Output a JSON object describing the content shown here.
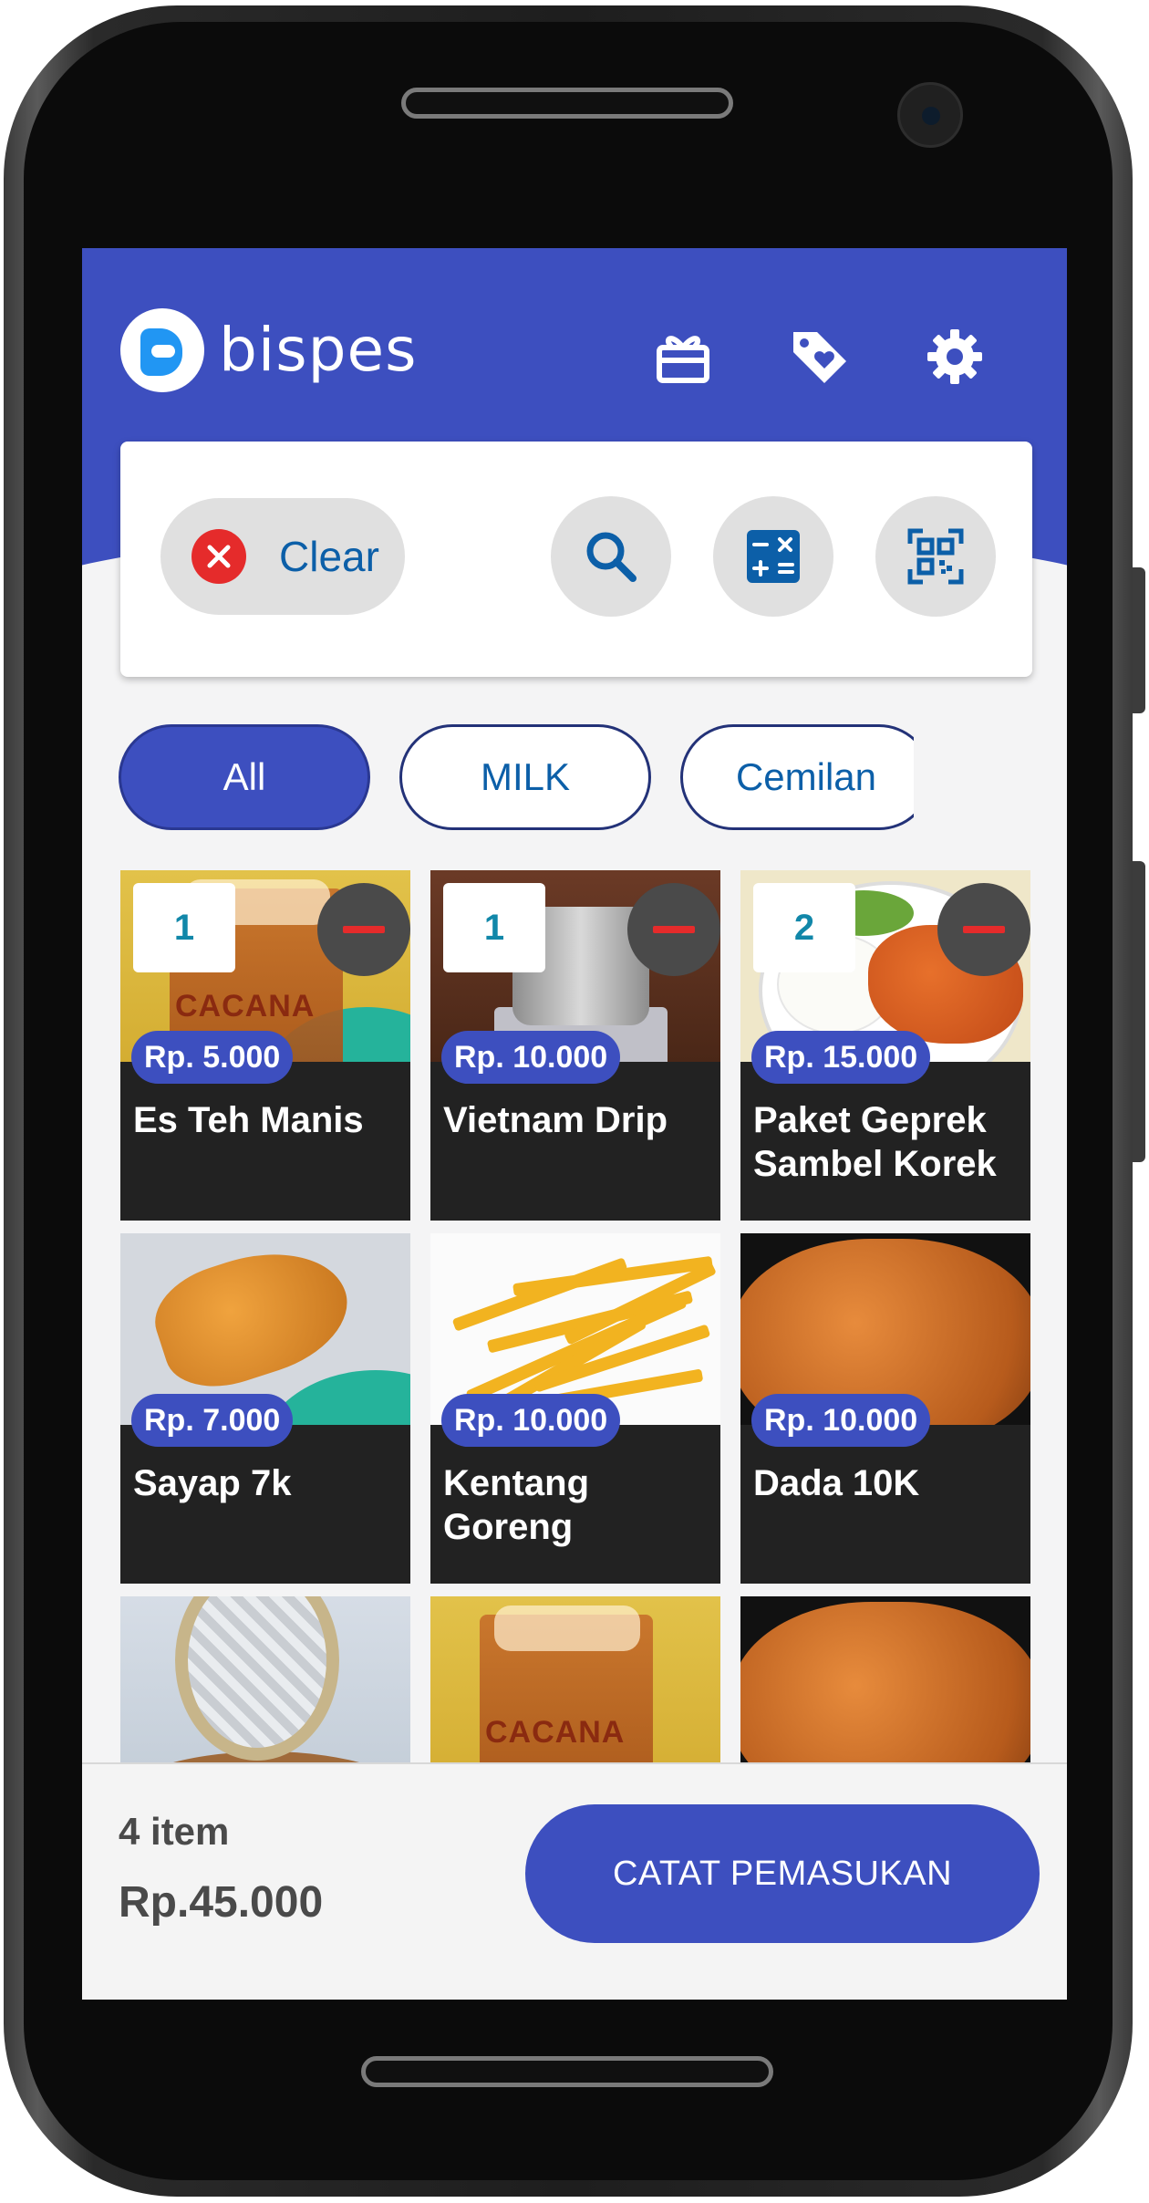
{
  "app": {
    "brand": "bispes"
  },
  "header": {
    "icons": [
      "gift-icon",
      "tag-heart-icon",
      "gear-icon"
    ]
  },
  "toolbar": {
    "clear_label": "Clear",
    "icons": [
      "search-icon",
      "calculator-icon",
      "qr-scan-icon"
    ]
  },
  "categories": [
    {
      "label": "All",
      "active": true
    },
    {
      "label": "MILK",
      "active": false
    },
    {
      "label": "Cemilan",
      "active": false
    },
    {
      "label": "",
      "active": false
    }
  ],
  "products": [
    {
      "name": "Es Teh Manis",
      "price": "Rp. 5.000",
      "qty": "1"
    },
    {
      "name": "Vietnam Drip",
      "price": "Rp. 10.000",
      "qty": "1"
    },
    {
      "name": "Paket Geprek Sambel Korek",
      "price": "Rp. 15.000",
      "qty": "2"
    },
    {
      "name": "Sayap 7k",
      "price": "Rp. 7.000",
      "qty": ""
    },
    {
      "name": "Kentang Goreng",
      "price": "Rp. 10.000",
      "qty": ""
    },
    {
      "name": "Dada 10K",
      "price": "Rp. 10.000",
      "qty": ""
    }
  ],
  "cart": {
    "item_count": "4 item",
    "total": "Rp.45.000",
    "cta_label": "CATAT PEMASUKAN"
  },
  "colors": {
    "primary": "#3d4fbf",
    "accent_text": "#0c5fa8",
    "danger": "#e52b2b",
    "qty_text": "#1187a9",
    "card_dark": "#222222"
  }
}
